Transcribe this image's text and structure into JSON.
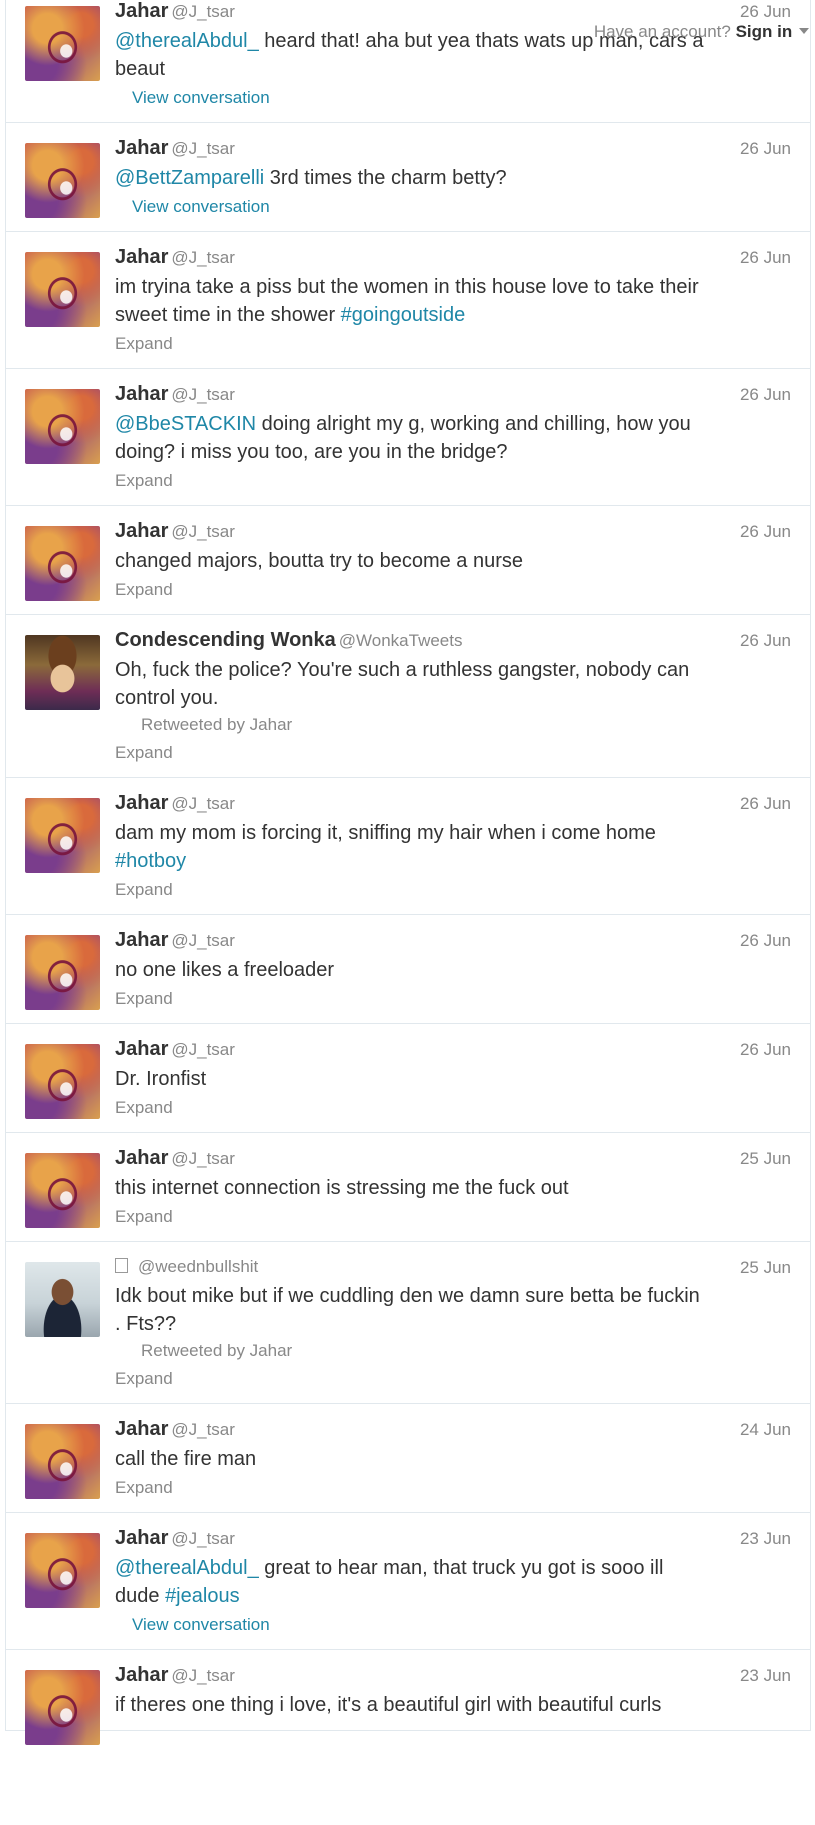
{
  "topbar": {
    "have_account": "Have an account?",
    "signin": "Sign in"
  },
  "tweets": [
    {
      "avatar": "jahar",
      "name": "Jahar",
      "handle": "@J_tsar",
      "date": "26 Jun",
      "parts": [
        {
          "t": "@therealAbdul_",
          "link": true
        },
        {
          "t": " heard that! aha but yea thats wats up man, cars a beaut",
          "link": false
        }
      ],
      "action": "View conversation",
      "action_type": "conversation"
    },
    {
      "avatar": "jahar",
      "name": "Jahar",
      "handle": "@J_tsar",
      "date": "26 Jun",
      "parts": [
        {
          "t": "@BettZamparelli",
          "link": true
        },
        {
          "t": " 3rd times the charm betty?",
          "link": false
        }
      ],
      "action": "View conversation",
      "action_type": "conversation"
    },
    {
      "avatar": "jahar",
      "name": "Jahar",
      "handle": "@J_tsar",
      "date": "26 Jun",
      "parts": [
        {
          "t": "im tryina take a piss but the women in this house love to take their sweet time in the shower ",
          "link": false
        },
        {
          "t": "#goingoutside",
          "link": true
        }
      ],
      "action": "Expand",
      "action_type": "expand"
    },
    {
      "avatar": "jahar",
      "name": "Jahar",
      "handle": "@J_tsar",
      "date": "26 Jun",
      "parts": [
        {
          "t": "@BbeSTACKIN",
          "link": true
        },
        {
          "t": " doing alright my g, working and chilling, how you doing? i miss you too, are you in the bridge?",
          "link": false
        }
      ],
      "action": "Expand",
      "action_type": "expand"
    },
    {
      "avatar": "jahar",
      "name": "Jahar",
      "handle": "@J_tsar",
      "date": "26 Jun",
      "parts": [
        {
          "t": "changed majors, boutta try to become a nurse",
          "link": false
        }
      ],
      "action": "Expand",
      "action_type": "expand"
    },
    {
      "avatar": "wonka",
      "name": "Condescending Wonka",
      "handle": "@WonkaTweets",
      "date": "26 Jun",
      "parts": [
        {
          "t": "Oh, fuck the police? You're such a ruthless gangster, nobody can control you.",
          "link": false
        }
      ],
      "retweet": "Retweeted by Jahar",
      "action": "Expand",
      "action_type": "expand"
    },
    {
      "avatar": "jahar",
      "name": "Jahar",
      "handle": "@J_tsar",
      "date": "26 Jun",
      "parts": [
        {
          "t": "dam my mom is forcing it, sniffing my hair when i come home ",
          "link": false
        },
        {
          "t": "#hotboy",
          "link": true
        }
      ],
      "action": "Expand",
      "action_type": "expand"
    },
    {
      "avatar": "jahar",
      "name": "Jahar",
      "handle": "@J_tsar",
      "date": "26 Jun",
      "parts": [
        {
          "t": "no one likes a freeloader",
          "link": false
        }
      ],
      "action": "Expand",
      "action_type": "expand"
    },
    {
      "avatar": "jahar",
      "name": "Jahar",
      "handle": "@J_tsar",
      "date": "26 Jun",
      "parts": [
        {
          "t": "Dr. Ironfist",
          "link": false
        }
      ],
      "action": "Expand",
      "action_type": "expand"
    },
    {
      "avatar": "jahar",
      "name": "Jahar",
      "handle": "@J_tsar",
      "date": "25 Jun",
      "parts": [
        {
          "t": "this internet connection is stressing me the fuck out",
          "link": false
        }
      ],
      "action": "Expand",
      "action_type": "expand"
    },
    {
      "avatar": "weed",
      "name": "",
      "name_icon": "missing-glyph-icon",
      "handle": "@weednbullshit",
      "date": "25 Jun",
      "parts": [
        {
          "t": "Idk bout mike but if we cuddling den we damn sure betta be fuckin . Fts??",
          "link": false
        }
      ],
      "retweet": "Retweeted by Jahar",
      "action": "Expand",
      "action_type": "expand"
    },
    {
      "avatar": "jahar",
      "name": "Jahar",
      "handle": "@J_tsar",
      "date": "24 Jun",
      "parts": [
        {
          "t": "call the fire man",
          "link": false
        }
      ],
      "action": "Expand",
      "action_type": "expand"
    },
    {
      "avatar": "jahar",
      "name": "Jahar",
      "handle": "@J_tsar",
      "date": "23 Jun",
      "parts": [
        {
          "t": "@therealAbdul_",
          "link": true
        },
        {
          "t": " great to hear man, that truck yu got is sooo ill dude ",
          "link": false
        },
        {
          "t": "#jealous",
          "link": true
        }
      ],
      "action": "View conversation",
      "action_type": "conversation"
    },
    {
      "avatar": "jahar",
      "name": "Jahar",
      "handle": "@J_tsar",
      "date": "23 Jun",
      "parts": [
        {
          "t": "if theres one thing i love, it's a beautiful girl with beautiful curls",
          "link": false
        }
      ],
      "action": "",
      "action_type": "none"
    }
  ]
}
